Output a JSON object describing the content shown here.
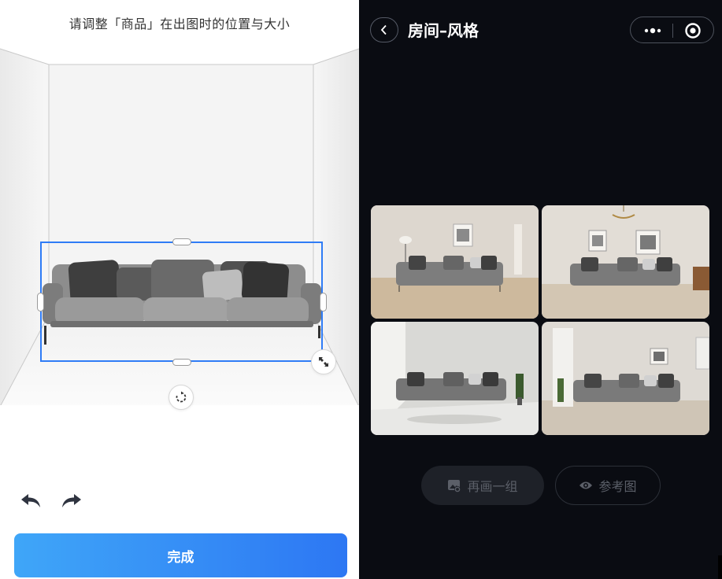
{
  "left_panel": {
    "hint": "请调整「商品」在出图时的位置与大小",
    "done_button": "完成",
    "accent": "#2f7cf6"
  },
  "right_panel": {
    "title": "房间–风格",
    "regen_button": "再画一组",
    "reference_button": "参考图",
    "thumbnails": [
      {
        "style": "warm-beige-living-room"
      },
      {
        "style": "chandelier-living-room"
      },
      {
        "style": "marble-floor-living-room"
      },
      {
        "style": "curtain-window-living-room"
      }
    ]
  },
  "icons": [
    "back-chevron-icon",
    "more-dots-icon",
    "close-target-icon",
    "resize-icon",
    "rotate-icon",
    "undo-icon",
    "redo-icon",
    "image-regenerate-icon",
    "eye-icon"
  ]
}
